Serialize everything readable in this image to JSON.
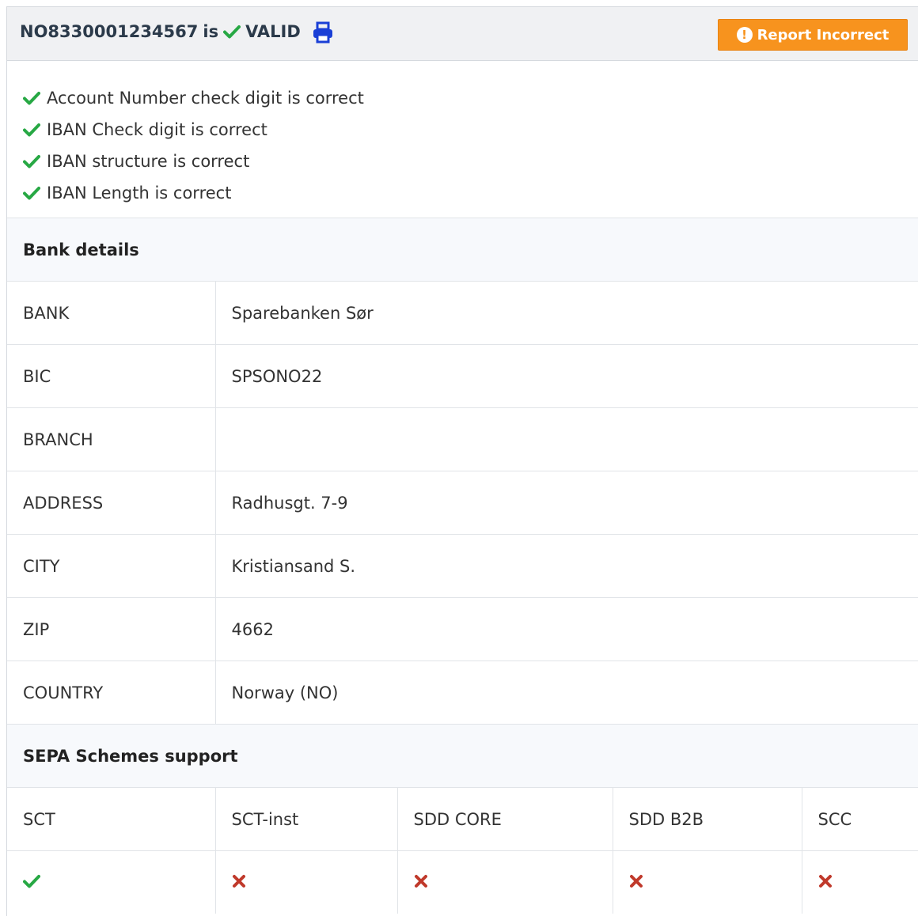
{
  "header": {
    "iban": "NO8330001234567",
    "is_text": "is",
    "status": "VALID",
    "report_label": "Report Incorrect"
  },
  "checks": [
    "Account Number check digit is correct",
    "IBAN Check digit is correct",
    "IBAN structure is correct",
    "IBAN Length is correct"
  ],
  "bank_details": {
    "heading": "Bank details",
    "rows": [
      {
        "label": "BANK",
        "value": "Sparebanken Sør"
      },
      {
        "label": "BIC",
        "value": "SPSONO22"
      },
      {
        "label": "BRANCH",
        "value": ""
      },
      {
        "label": "ADDRESS",
        "value": "Radhusgt. 7-9"
      },
      {
        "label": "CITY",
        "value": "Kristiansand S."
      },
      {
        "label": "ZIP",
        "value": "4662"
      },
      {
        "label": "COUNTRY",
        "value": "Norway (NO)"
      }
    ]
  },
  "sepa": {
    "heading": "SEPA Schemes support",
    "schemes": [
      {
        "name": "SCT",
        "supported": true
      },
      {
        "name": "SCT-inst",
        "supported": false
      },
      {
        "name": "SDD CORE",
        "supported": false
      },
      {
        "name": "SDD B2B",
        "supported": false
      },
      {
        "name": "SCC",
        "supported": false
      }
    ]
  },
  "colors": {
    "valid_green": "#27a844",
    "invalid_red": "#c0392b",
    "report_orange": "#f7931e",
    "print_blue": "#1a3fd6"
  },
  "icons": {
    "valid": "check-icon",
    "invalid": "cross-icon",
    "print": "print-icon",
    "report": "exclamation-icon"
  }
}
